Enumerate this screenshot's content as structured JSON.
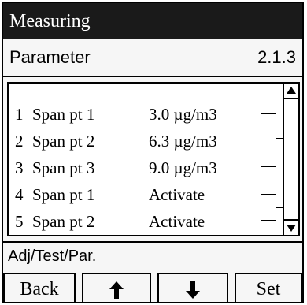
{
  "title": "Measuring",
  "parameter": {
    "label": "Parameter",
    "code": "2.1.3"
  },
  "rows": [
    {
      "num": "1",
      "name": "Span pt 1",
      "value": "3.0 µg/m3"
    },
    {
      "num": "2",
      "name": "Span pt 2",
      "value": "6.3 µg/m3"
    },
    {
      "num": "3",
      "name": "Span pt 3",
      "value": "9.0 µg/m3"
    },
    {
      "num": "4",
      "name": "Span pt 1",
      "value": "Activate"
    },
    {
      "num": "5",
      "name": "Span pt 2",
      "value": "Activate"
    }
  ],
  "status": "Adj/Test/Par.",
  "softkeys": {
    "back": "Back",
    "set": "Set",
    "up_icon": "arrow-up-icon",
    "down_icon": "arrow-down-icon"
  },
  "scrollbar": {
    "up_icon": "scroll-up-icon",
    "down_icon": "scroll-down-icon"
  }
}
